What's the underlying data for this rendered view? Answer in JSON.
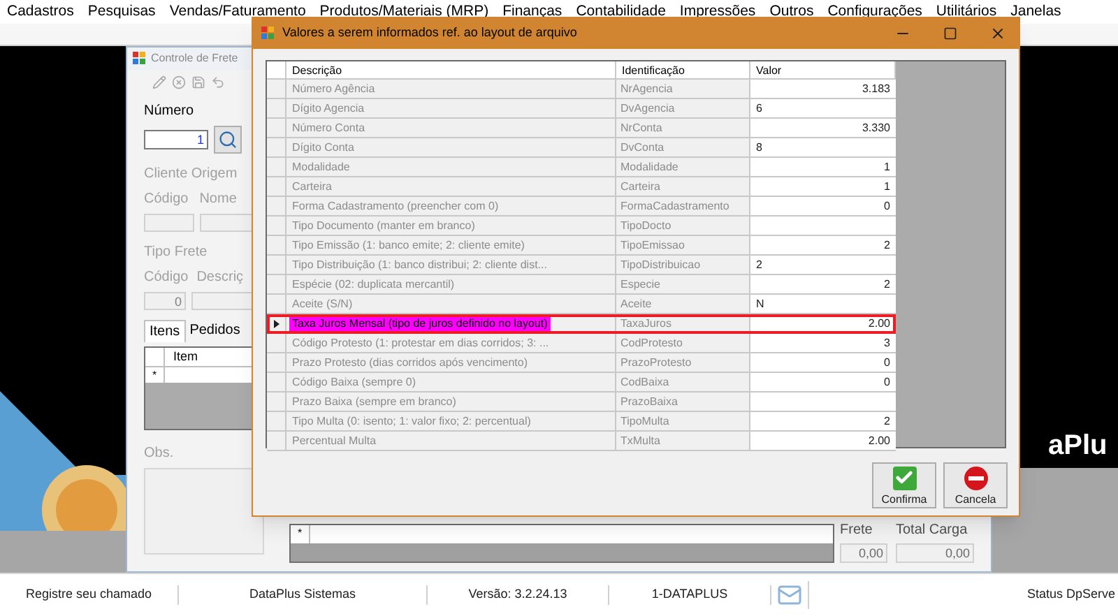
{
  "menu": [
    "Cadastros",
    "Pesquisas",
    "Vendas/Faturamento",
    "Produtos/Materiais (MRP)",
    "Finanças",
    "Contabilidade",
    "Impressões",
    "Outros",
    "Configurações",
    "Utilitários",
    "Janelas"
  ],
  "background_window": {
    "title": "Controle de Frete",
    "numero_label": "Número",
    "numero_value": "1",
    "cliente_origem": {
      "title": "Cliente Origem",
      "labels": [
        "Código",
        "Nome"
      ]
    },
    "tipo_frete": {
      "title": "Tipo Frete",
      "labels": [
        "Código",
        "Descriç"
      ],
      "codigo_value": "0"
    },
    "tabs": [
      {
        "label": "Itens",
        "selected": true
      },
      {
        "label": "Pedidos",
        "selected": false
      }
    ],
    "items_grid": {
      "column": "Item",
      "new_row_marker": "*"
    },
    "obs_label": "Obs.",
    "lower_grid_marker": "*",
    "totals": [
      {
        "label": "Frete",
        "value": "0,00"
      },
      {
        "label": "Total Carga",
        "value": "0,00"
      }
    ]
  },
  "logo_text": "aPlu",
  "dialog": {
    "title": "Valores a serem informados ref. ao layout de arquivo",
    "columns": [
      "Descrição",
      "Identificação",
      "Valor"
    ],
    "rows": [
      {
        "description": "Número Agência",
        "identification": "NrAgencia",
        "value": "3.183",
        "kind": "number",
        "selected": false,
        "marked": false
      },
      {
        "description": "Dígito Agencia",
        "identification": "DvAgencia",
        "value": "6",
        "kind": "text",
        "selected": false,
        "marked": false
      },
      {
        "description": "Número Conta",
        "identification": "NrConta",
        "value": "3.330",
        "kind": "number",
        "selected": false,
        "marked": false
      },
      {
        "description": "Dígito Conta",
        "identification": "DvConta",
        "value": "8",
        "kind": "text",
        "selected": false,
        "marked": false
      },
      {
        "description": "Modalidade",
        "identification": "Modalidade",
        "value": "1",
        "kind": "number",
        "selected": false,
        "marked": false
      },
      {
        "description": "Carteira",
        "identification": "Carteira",
        "value": "1",
        "kind": "number",
        "selected": false,
        "marked": false
      },
      {
        "description": "Forma Cadastramento (preencher com 0)",
        "identification": "FormaCadastramento",
        "value": "0",
        "kind": "number",
        "selected": false,
        "marked": false
      },
      {
        "description": "Tipo Documento (manter em branco)",
        "identification": "TipoDocto",
        "kind": "text",
        "selected": false,
        "marked": false
      },
      {
        "description": "Tipo Emissão (1: banco emite; 2: cliente emite)",
        "identification": "TipoEmissao",
        "value": "2",
        "kind": "number",
        "selected": false,
        "marked": false
      },
      {
        "description": "Tipo Distribuição (1: banco distribui; 2: cliente dist...",
        "identification": "TipoDistribuicao",
        "value": "2",
        "kind": "text",
        "selected": false,
        "marked": false
      },
      {
        "description": "Espécie (02: duplicata mercantil)",
        "identification": "Especie",
        "value": "2",
        "kind": "number",
        "selected": false,
        "marked": false
      },
      {
        "description": "Aceite (S/N)",
        "identification": "Aceite",
        "value": "N",
        "kind": "text",
        "selected": false,
        "marked": false
      },
      {
        "description": "Taxa Juros Mensal (tipo de juros definido no layout)",
        "identification": "TaxaJuros",
        "value": "2.00",
        "kind": "number",
        "selected": true,
        "marked": true
      },
      {
        "description": "Código Protesto (1: protestar em dias corridos; 3: ...",
        "identification": "CodProtesto",
        "value": "3",
        "kind": "number",
        "selected": false,
        "marked": false
      },
      {
        "description": "Prazo Protesto (dias corridos após vencimento)",
        "identification": "PrazoProtesto",
        "value": "0",
        "kind": "number",
        "selected": false,
        "marked": false
      },
      {
        "description": "Código Baixa (sempre 0)",
        "identification": "CodBaixa",
        "value": "0",
        "kind": "number",
        "selected": false,
        "marked": false
      },
      {
        "description": "Prazo Baixa (sempre em branco)",
        "identification": "PrazoBaixa",
        "kind": "text",
        "selected": false,
        "marked": false
      },
      {
        "description": "Tipo Multa (0: isento; 1: valor fixo; 2: percentual)",
        "identification": "TipoMulta",
        "value": "2",
        "kind": "number",
        "selected": false,
        "marked": false
      },
      {
        "description": "Percentual Multa",
        "identification": "TxMulta",
        "value": "2.00",
        "kind": "number",
        "selected": false,
        "marked": false
      }
    ],
    "buttons": [
      {
        "label": "Confirma",
        "kind": "confirm"
      },
      {
        "label": "Cancela",
        "kind": "cancel"
      }
    ]
  },
  "status_bar": [
    "Registre seu chamado",
    "DataPlus Sistemas",
    "Versão: 3.2.24.13",
    "1-DATAPLUS",
    "Status DpServe"
  ]
}
